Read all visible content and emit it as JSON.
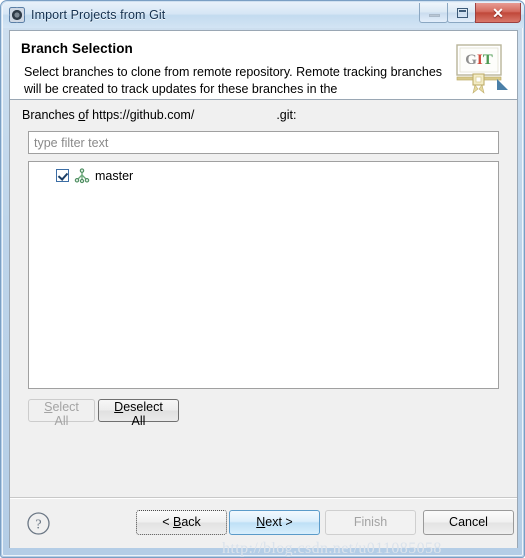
{
  "window": {
    "title": "Import Projects from Git",
    "icon": "eclipse-gear-icon",
    "controls": {
      "minimize": "minimize-icon",
      "restore": "restore-icon",
      "close": "✕"
    }
  },
  "wizard": {
    "heading": "Branch Selection",
    "description": "Select branches to clone from remote repository. Remote tracking branches will be created to track updates for these branches in the",
    "banner_icon": "git-certificate-logo",
    "banner_text": "GIT"
  },
  "branches": {
    "label_prefix": "Branches ",
    "label_mnemonic": "o",
    "label_suffix": "f https://github.com/",
    "label_redacted": "████████████",
    "label_end": ".git:",
    "filter": {
      "value": "",
      "placeholder": "type filter text"
    },
    "items": [
      {
        "label": "master",
        "checked": true,
        "icon": "git-branch-icon"
      }
    ],
    "select_all": {
      "label_mnemonic": "S",
      "label_rest": "elect All",
      "enabled": false
    },
    "deselect_all": {
      "label_mnemonic": "D",
      "label_rest": "eselect All",
      "enabled": true
    }
  },
  "buttonbar": {
    "help": "help-icon",
    "back": {
      "pre": "< ",
      "mnemonic": "B",
      "post": "ack"
    },
    "next": {
      "pre": "",
      "mnemonic": "N",
      "post": "ext >"
    },
    "finish": {
      "pre": "",
      "mnemonic": "F",
      "post": "inish"
    },
    "cancel": {
      "pre": "",
      "mnemonic": "C",
      "post": "ancel"
    }
  },
  "watermark": {
    "text": "http://blog.csdn.net/u011085058"
  },
  "colors": {
    "titlebar_accent": "#c3dbef",
    "close_button": "#c0483a",
    "default_button": "#bfe0f6",
    "branch_icon": "#5f9e6e",
    "checkbox_border": "#3c6ea5"
  }
}
